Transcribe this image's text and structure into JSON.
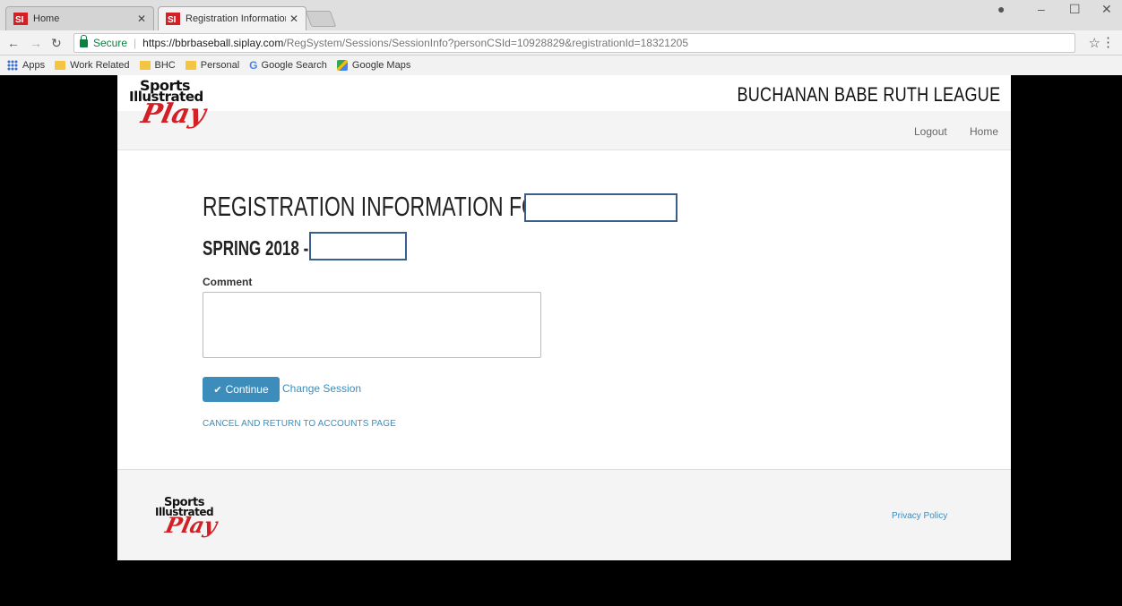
{
  "browser": {
    "tabs": [
      {
        "title": "Home",
        "active": false
      },
      {
        "title": "Registration Information",
        "active": true
      }
    ],
    "address": {
      "secure_label": "Secure",
      "url_host": "https://bbrbaseball.siplay.com",
      "url_path": "/RegSystem/Sessions/SessionInfo?personCSId=10928829&registrationId=18321205"
    },
    "bookmarks": [
      {
        "label": "Apps",
        "icon": "apps-grid-icon"
      },
      {
        "label": "Work Related",
        "icon": "folder-icon"
      },
      {
        "label": "BHC",
        "icon": "folder-icon"
      },
      {
        "label": "Personal",
        "icon": "folder-icon"
      },
      {
        "label": "Google Search",
        "icon": "google-icon"
      },
      {
        "label": "Google Maps",
        "icon": "google-maps-icon"
      }
    ]
  },
  "site": {
    "logo": {
      "line1": "Sports",
      "line2": "Illustrated",
      "line3": "Play"
    },
    "league_name": "BUCHANAN BABE RUTH LEAGUE",
    "nav": {
      "logout": "Logout",
      "home": "Home"
    }
  },
  "main": {
    "heading": "REGISTRATION INFORMATION FOR",
    "subheading": "SPRING 2018 -",
    "comment_label": "Comment",
    "comment_value": "",
    "continue_label": "Continue",
    "change_session_label": "Change Session",
    "cancel_label": "CANCEL AND RETURN TO ACCOUNTS PAGE"
  },
  "footer": {
    "privacy_label": "Privacy Policy"
  },
  "colors": {
    "accent": "#3c8dbc",
    "logo_red": "#d32027",
    "redaction_border": "#3b5f8a"
  }
}
